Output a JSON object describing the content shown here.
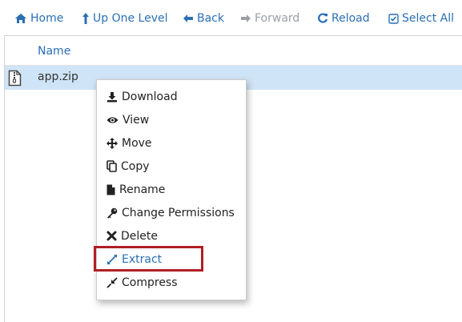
{
  "toolbar": {
    "home": "Home",
    "up_one_level": "Up One Level",
    "back": "Back",
    "forward": "Forward",
    "reload": "Reload",
    "select_all": "Select All"
  },
  "table": {
    "name_header": "Name",
    "rows": [
      {
        "name": "app.zip",
        "icon": "zip-file-icon"
      }
    ]
  },
  "context_menu": {
    "items": [
      {
        "label": "Download",
        "icon": "download-icon"
      },
      {
        "label": "View",
        "icon": "eye-icon"
      },
      {
        "label": "Move",
        "icon": "move-arrows-icon"
      },
      {
        "label": "Copy",
        "icon": "copy-icon"
      },
      {
        "label": "Rename",
        "icon": "file-icon"
      },
      {
        "label": "Change Permissions",
        "icon": "key-icon"
      },
      {
        "label": "Delete",
        "icon": "x-icon"
      },
      {
        "label": "Extract",
        "icon": "expand-icon",
        "highlighted": true
      },
      {
        "label": "Compress",
        "icon": "compress-icon"
      }
    ]
  },
  "colors": {
    "link": "#2a6fb3",
    "disabled": "#9aa0a6",
    "selected_row": "#cfe4f6",
    "highlight_box": "#b01f24"
  }
}
